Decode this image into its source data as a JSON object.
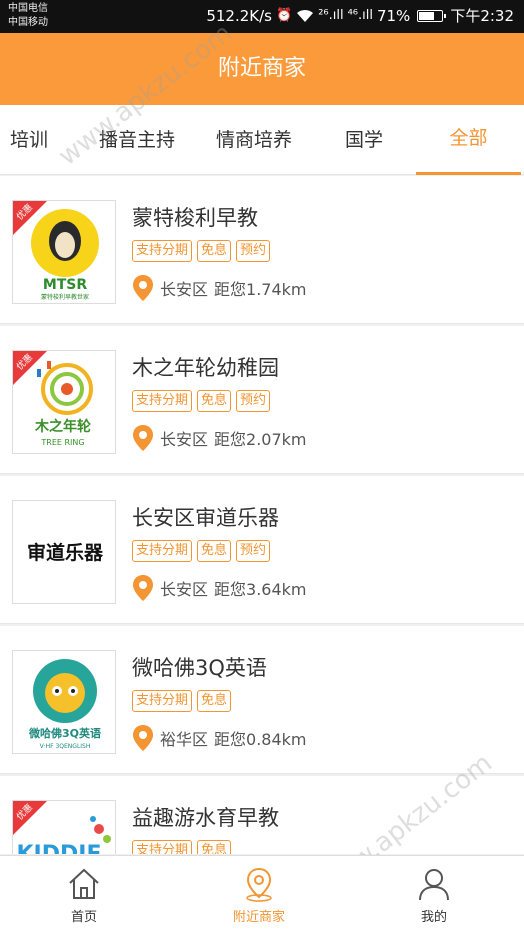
{
  "status_bar": {
    "carrier_1": "中国电信",
    "carrier_2": "中国移动",
    "speed": "512.2K/s",
    "signal_1": "²⁶.ıll",
    "signal_2": "⁴⁶.ıll",
    "battery": "71%",
    "battery_level": 0.71,
    "time": "下午2:32"
  },
  "header": {
    "title": "附近商家"
  },
  "tabs": [
    {
      "label": "培训",
      "active": false
    },
    {
      "label": "播音主持",
      "active": false
    },
    {
      "label": "情商培养",
      "active": false
    },
    {
      "label": "国学",
      "active": false
    },
    {
      "label": "全部",
      "active": true
    }
  ],
  "merchants": [
    {
      "name": "蒙特梭利早教",
      "badge": "优惠",
      "logo_text": "MTSR",
      "logo_sub": "蒙特梭利早教世家",
      "tags": [
        "支持分期",
        "免息",
        "预约"
      ],
      "district": "长安区",
      "distance": "距您1.74km"
    },
    {
      "name": "木之年轮幼稚园",
      "badge": "优惠",
      "logo_text": "木之年轮",
      "logo_sub": "TREE RING",
      "tags": [
        "支持分期",
        "免息",
        "预约"
      ],
      "district": "长安区",
      "distance": "距您2.07km"
    },
    {
      "name": "长安区审道乐器",
      "badge": "",
      "logo_text": "审道乐器",
      "logo_sub": "",
      "tags": [
        "支持分期",
        "免息",
        "预约"
      ],
      "district": "长安区",
      "distance": "距您3.64km"
    },
    {
      "name": "微哈佛3Q英语",
      "badge": "",
      "logo_text": "微哈佛3Q英语",
      "logo_sub": "V·HF 3QENGLISH",
      "tags": [
        "支持分期",
        "免息"
      ],
      "district": "裕华区",
      "distance": "距您0.84km"
    },
    {
      "name": "益趣游水育早教",
      "badge": "优惠",
      "logo_text": "KIDDIE",
      "logo_sub": "",
      "tags": [
        "支持分期",
        "免息"
      ],
      "district": "",
      "distance": ""
    }
  ],
  "bottom_nav": [
    {
      "label": "首页",
      "icon": "home-icon",
      "active": false
    },
    {
      "label": "附近商家",
      "icon": "location-icon",
      "active": true
    },
    {
      "label": "我的",
      "icon": "user-icon",
      "active": false
    }
  ],
  "watermark": "www.apkzu.com",
  "colors": {
    "accent": "#f39532",
    "header": "#fb9a3a",
    "badge": "#e83a3a"
  }
}
